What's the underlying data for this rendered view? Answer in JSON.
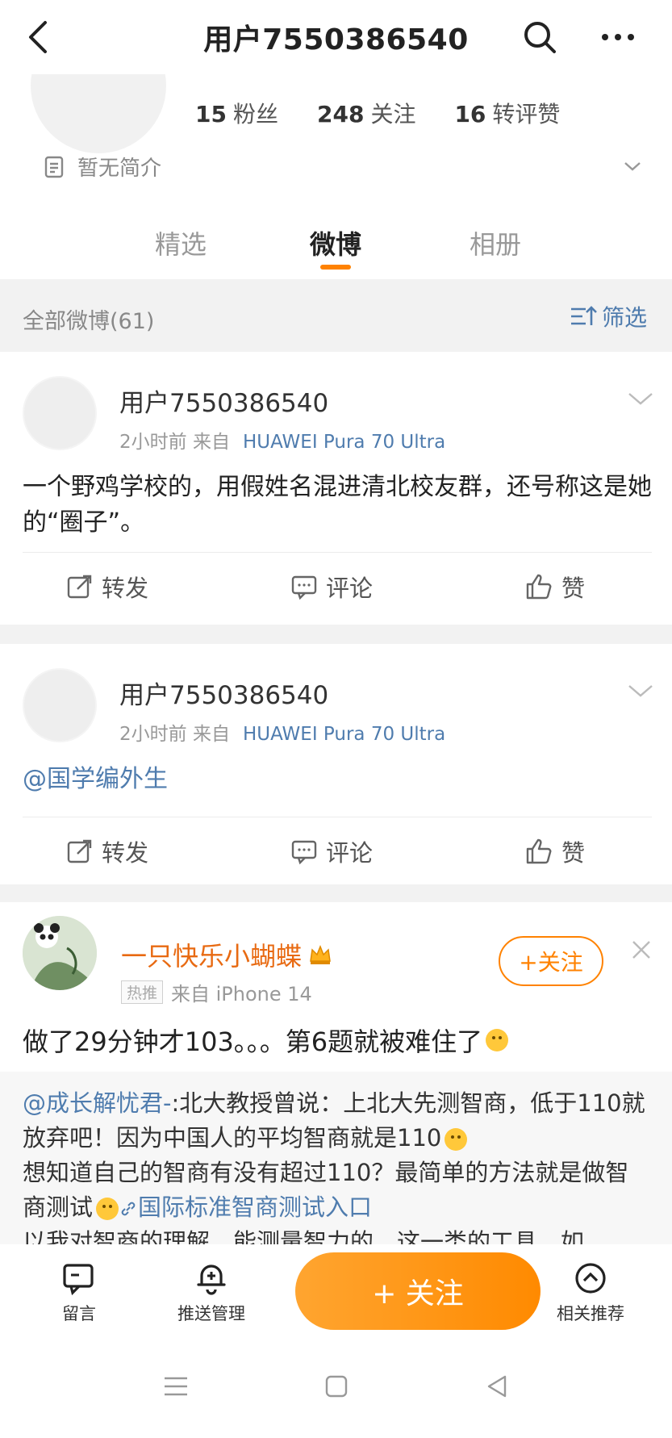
{
  "header": {
    "title": "用户7550386540"
  },
  "profile": {
    "stats": [
      {
        "value": "15",
        "label": "粉丝"
      },
      {
        "value": "248",
        "label": "关注"
      },
      {
        "value": "16",
        "label": "转评赞"
      }
    ],
    "bio": "暂无简介"
  },
  "tabs": [
    {
      "label": "精选",
      "active": false
    },
    {
      "label": "微博",
      "active": true
    },
    {
      "label": "相册",
      "active": false
    }
  ],
  "filterbar": {
    "count_label": "全部微博(61)",
    "filter_label": "筛选"
  },
  "posts": [
    {
      "username": "用户7550386540",
      "time": "2小时前",
      "source_prefix": "来自",
      "device": "HUAWEI Pura 70 Ultra",
      "content": "一个野鸡学校的，用假姓名混进清北校友群，还号称这是她的“圈子”。"
    },
    {
      "username": "用户7550386540",
      "time": "2小时前",
      "source_prefix": "来自",
      "device": "HUAWEI Pura 70 Ultra",
      "content": "@国学编外生"
    }
  ],
  "actions": {
    "repost": "转发",
    "comment": "评论",
    "like": "赞"
  },
  "recommended": {
    "username": "一只快乐小蝴蝶",
    "tag": "热推",
    "source": "来自 iPhone 14",
    "follow_label": "+关注",
    "content": "做了29分钟才103。。。第6题就被难住了",
    "repost_mention": "@成长解忧君-",
    "repost_text_1": ":北大教授曾说：上北大先测智商，低于110就放弃吧！因为中国人的平均智商就是110",
    "repost_text_2": "想知道自己的智商有没有超过110？最简单的方法就是做智商测试",
    "repost_link": "国际标准智商测试入口",
    "repost_text_3": "以我对智商的理解，能测量智力的，这一类的工具，如"
  },
  "bottombar": {
    "message": "留言",
    "push": "推送管理",
    "follow": "+ 关注",
    "related": "相关推荐"
  },
  "colors": {
    "accent": "#ff8200",
    "link": "#4f7cae"
  }
}
